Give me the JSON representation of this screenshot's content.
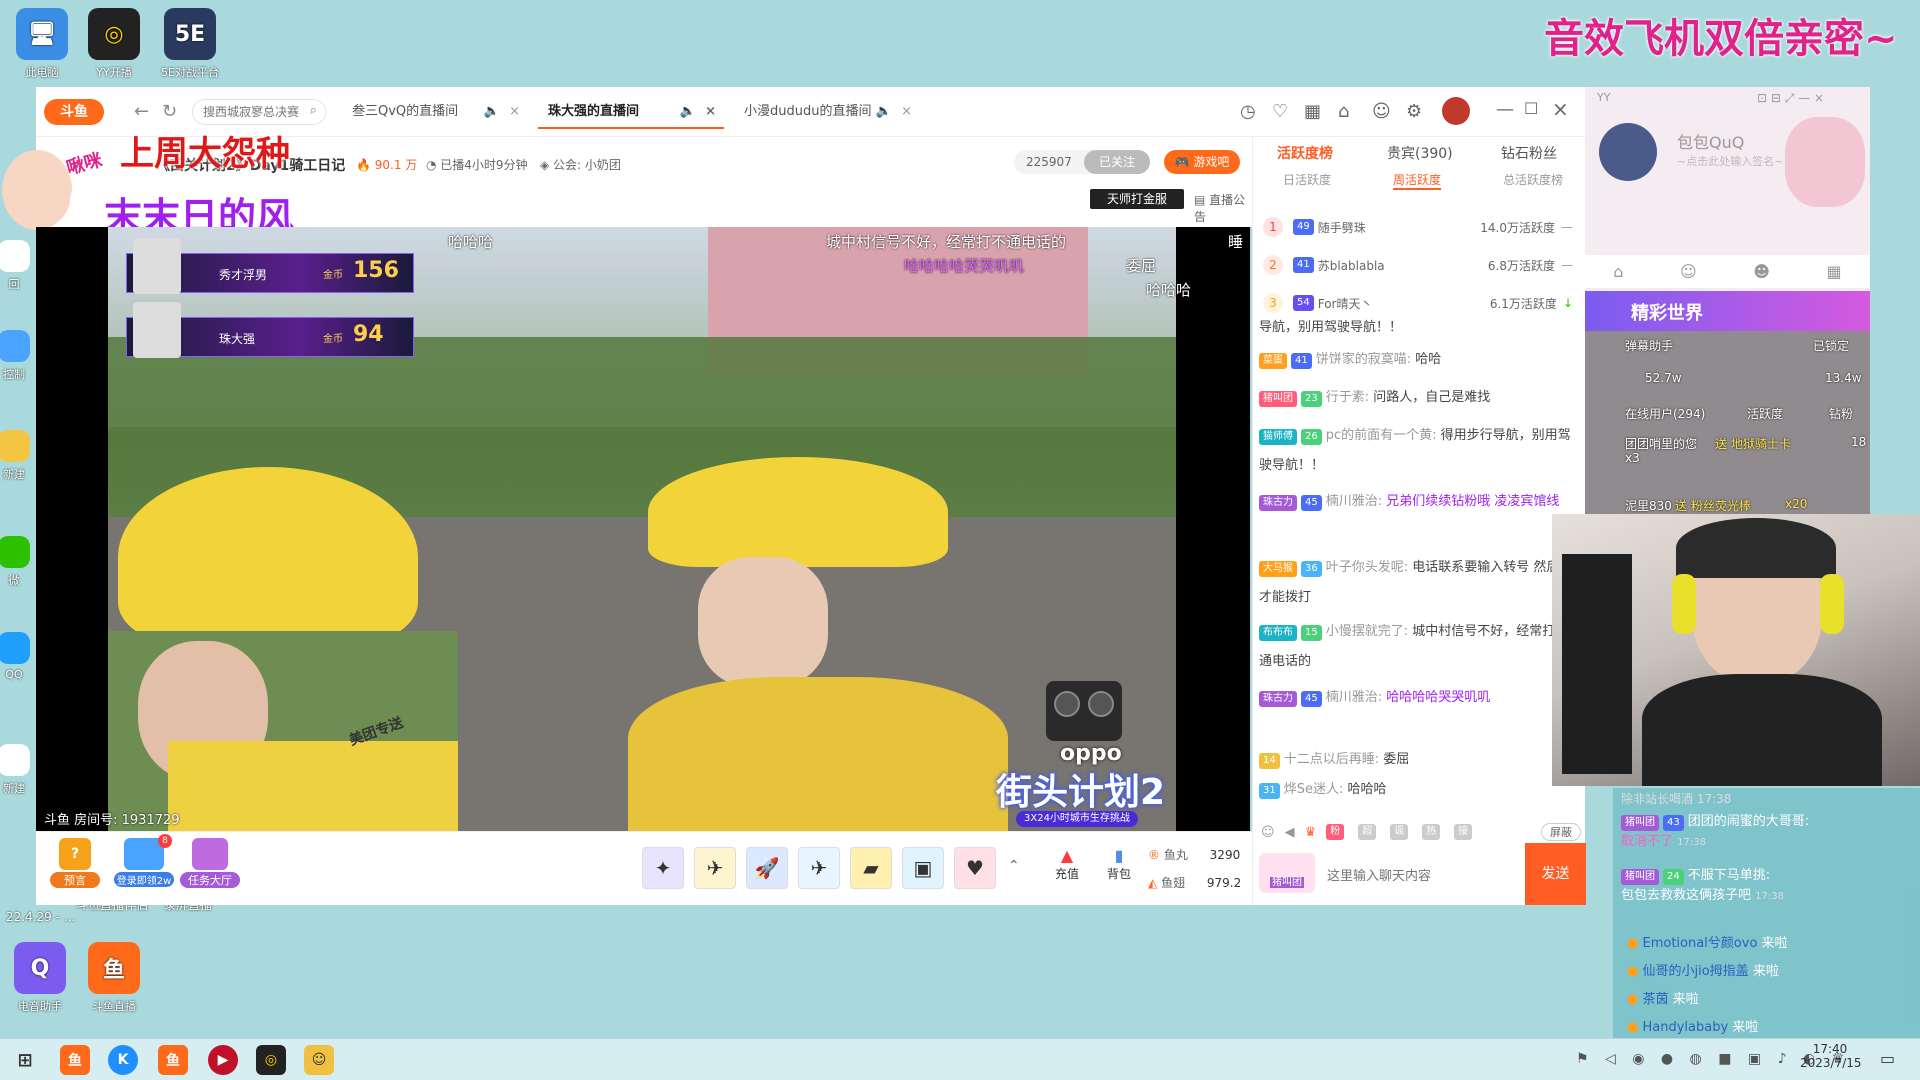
{
  "desktop": {
    "icons_top": [
      {
        "label": "此电脑",
        "icon": "computer-icon",
        "color": "#3a8ee6"
      },
      {
        "label": "YY开播",
        "icon": "yy-live-icon",
        "color": "#ffd100"
      },
      {
        "label": "5E对战平台",
        "icon": "5e-platform-icon",
        "color": "#2a3a5e"
      }
    ],
    "icons_left": [
      {
        "label": "回",
        "icon": "recycle-icon"
      },
      {
        "label": "控制",
        "icon": "control-icon"
      },
      {
        "label": "新建",
        "icon": "folder-icon"
      },
      {
        "label": "微",
        "icon": "wechat-icon"
      },
      {
        "label": "QQ",
        "icon": "qq-icon"
      },
      {
        "label": "新建",
        "icon": "file-icon"
      }
    ],
    "icons_bottom": [
      {
        "label": "电音助手",
        "icon": "audio-assistant-icon",
        "color": "#7a5cf0"
      },
      {
        "label": "斗鱼直播",
        "icon": "douyu-icon",
        "color": "#ff6a1a"
      }
    ],
    "partial_labels": [
      "直播伴侣",
      "斗鱼直播伴侣",
      "录屏直播"
    ],
    "partial_date": "22.4.29 - ..."
  },
  "overlay_title": "音效飞机双倍亲密~",
  "stickers": {
    "line1": "上周大怨种",
    "line2": "末末日的风",
    "bubble": "啾咪"
  },
  "browser": {
    "search_placeholder": "搜西城寂寥总决赛",
    "tabs": [
      {
        "label": "叁三QvQ的直播间",
        "active": false
      },
      {
        "label": "珠大强的直播间",
        "active": true
      },
      {
        "label": "小漫dududu的直播间",
        "active": false
      }
    ]
  },
  "stream": {
    "title": "《西关计划2》Day1骑工日记",
    "heat": "90.1 万",
    "duration": "已播4小时9分钟",
    "guild": "公会: 小奶团",
    "follow_count": "225907",
    "follow_label": "已关注",
    "game_button": "游戏吧",
    "badge_text": "天师打金服",
    "announce": "直播公告"
  },
  "video": {
    "pk_cards": [
      {
        "name": "秀才浮男",
        "label": "金币",
        "score": "156"
      },
      {
        "name": "珠大强",
        "label": "金币",
        "score": "94"
      }
    ],
    "danmaku": [
      "哈哈哈",
      "城中村信号不好，经常打不通电话的",
      "哈哈哈哈哭哭叽叽",
      "委屈",
      "哈哈哈",
      "睡"
    ],
    "room_info": "斗鱼 房间号: 1931729",
    "brand": "oppo",
    "event_logo": "街头计划2",
    "event_sub": "3X24小时城市生存挑战",
    "helmet_text": "美团专送"
  },
  "bottombar": {
    "left_items": [
      {
        "label": "预言",
        "icon": "prophecy-icon"
      },
      {
        "label": "登录即领2w",
        "icon": "login-gift-icon",
        "badge": "8"
      },
      {
        "label": "任务大厅",
        "icon": "task-hall-icon"
      }
    ],
    "gifts": [
      "gift-rocket-icon",
      "gift-plane-icon",
      "gift-spaceship-icon",
      "gift-jet-icon",
      "gift-ticket-icon",
      "gift-box-icon",
      "gift-card-icon"
    ],
    "recharge": "充值",
    "backpack": "背包",
    "fishball_label": "鱼丸",
    "fishball_value": "3290",
    "fishwing_label": "鱼翅",
    "fishwing_value": "979.2"
  },
  "panel": {
    "tabs": [
      "活跃度榜",
      "贵宾(390)",
      "钻石粉丝"
    ],
    "subtabs": [
      "日活跃度",
      "周活跃度",
      "总活跃度榜"
    ],
    "ranks": [
      {
        "no": "1",
        "level": "49",
        "name": "随手劈珠",
        "value": "14.0万活跃度",
        "trend": "—"
      },
      {
        "no": "2",
        "level": "41",
        "name": "苏blablabla",
        "value": "6.8万活跃度",
        "trend": "—"
      },
      {
        "no": "3",
        "level": "54",
        "name": "For晴天丶",
        "value": "6.1万活跃度",
        "trend": "↓"
      }
    ],
    "messages": [
      {
        "badge": "",
        "level": "",
        "user": "",
        "text": "导航，别用驾驶导航！！"
      },
      {
        "badge": "菜蛋",
        "level": "41",
        "user": "饼饼家的寂寞喵:",
        "text": "哈哈"
      },
      {
        "badge": "猪叫团",
        "level": "23",
        "user": "行于素:",
        "text": "问路人，自己是难找"
      },
      {
        "badge": "猫师傅",
        "level": "26",
        "user": "pc的前面有一个黄:",
        "text": "得用步行导航，别用驾驶导航！！"
      },
      {
        "badge": "珠古力",
        "level": "45",
        "user": "楠川雅治:",
        "text": "兄弟们续续钻粉哦 凌凌宾馆线"
      },
      {
        "badge": "大马猴",
        "level": "36",
        "user": "叶子你头发呢:",
        "text": "电话联系要输入转号 然后#才能拨打"
      },
      {
        "badge": "布布布",
        "level": "15",
        "user": "小慢摆就完了:",
        "text": "城中村信号不好，经常打不通电话的"
      },
      {
        "badge": "珠古力",
        "level": "45",
        "user": "楠川雅治:",
        "text": "哈哈哈哈哭哭叽叽"
      },
      {
        "badge": "",
        "level": "14",
        "user": "十二点以后再睡:",
        "text": "委屈"
      },
      {
        "badge": "",
        "level": "31",
        "user": "烨Se迷人:",
        "text": "哈哈哈"
      }
    ],
    "chat_tools": [
      "粉",
      "超",
      "谣",
      "热",
      "接"
    ],
    "shield_label": "屏蔽",
    "input_placeholder": "这里输入聊天内容",
    "send_label": "发送",
    "avatar_badge": "猪叫团"
  },
  "yy": {
    "username": "包包QuQ",
    "signature": "~点击此处输入签名~",
    "banner": "精彩世界",
    "assistant": "弹幕助手",
    "locked": "已锁定",
    "likes": "52.7w",
    "likes2": "13.4w",
    "online": "在线用户(294)",
    "activity": "活跃度",
    "diamond": "钻粉",
    "count": "18",
    "line1_user": "团团哨里的您",
    "line1_action": "送 地狱骑士卡",
    "line1_count": "x3",
    "messages": [
      {
        "user": "猪叫团",
        "level": "43",
        "name": "团团的闹蜜的大哥哥:",
        "text": "取消不了",
        "time": "17:38"
      },
      {
        "user": "猪叫团",
        "level": "24",
        "name": "不服下马单挑:",
        "text": "包包去救救这俩孩子吧",
        "time": "17:38"
      }
    ],
    "joins": [
      {
        "name": "Emotional兮颜ovo",
        "text": "来啦"
      },
      {
        "name": "仙哥的小jio拇指盖",
        "text": "来啦"
      },
      {
        "name": "茶茵",
        "text": "来啦"
      },
      {
        "name": "Handylababy",
        "text": "来啦"
      }
    ],
    "partial_above": "除非站长喝酒",
    "partial_time": "17:38",
    "gift_line": "送 粉丝荧光棒",
    "gift_count": "x20",
    "gift_user": "泥里830"
  },
  "taskbar": {
    "time": "17:40",
    "date": "2023/7/15",
    "apps": [
      "windows-icon",
      "douyu-app-icon",
      "kugou-icon",
      "douyu-live-icon",
      "netease-music-icon",
      "yy-icon",
      "chat-icon"
    ]
  },
  "colors": {
    "accent": "#ff5d23",
    "pink": "#e0228a",
    "purple": "#a020f0",
    "desktop": "#a9d9dc"
  }
}
